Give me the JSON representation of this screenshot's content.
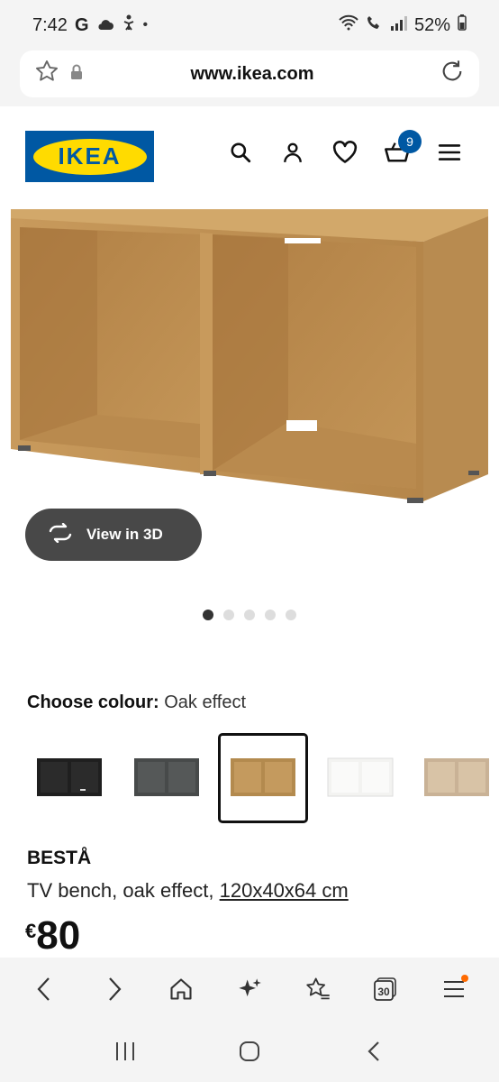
{
  "status": {
    "time": "7:42",
    "g_label": "G",
    "battery": "52%",
    "icons": [
      "cloud-icon",
      "accessibility-icon",
      "dot-icon",
      "wifi-icon",
      "call-icon",
      "signal-icon",
      "battery-icon"
    ]
  },
  "browser": {
    "url": "www.ikea.com",
    "icons": [
      "star-icon",
      "lock-icon",
      "reload-icon"
    ]
  },
  "header": {
    "logo_text": "IKEA",
    "cart_count": "9",
    "icons": [
      "search-icon",
      "user-icon",
      "heart-icon",
      "cart-icon",
      "menu-icon"
    ],
    "brand_colors": {
      "blue": "#0058a3",
      "yellow": "#ffdb00"
    }
  },
  "gallery": {
    "view3d_label": "View in 3D",
    "dot_count": 5,
    "active_index": 0
  },
  "colour": {
    "label": "Choose colour:",
    "value": "Oak effect",
    "options": [
      {
        "name": "black-brown",
        "color": "#1f1f1f",
        "selected": false
      },
      {
        "name": "dark-grey",
        "color": "#474a4a",
        "selected": false
      },
      {
        "name": "oak-effect",
        "color": "#b38a4e",
        "selected": true
      },
      {
        "name": "white",
        "color": "#f3f3f1",
        "selected": false
      },
      {
        "name": "white-stained-oak",
        "color": "#c9b296",
        "selected": false
      }
    ]
  },
  "product": {
    "name": "BESTÅ",
    "description": "TV bench, oak effect,",
    "dimensions": "120x40x64 cm",
    "currency": "€",
    "price": "80"
  },
  "toolbar": {
    "tabs_count": "30",
    "icons": [
      "back-icon",
      "forward-icon",
      "home-icon",
      "sparkle-icon",
      "bookmark-add-icon",
      "tabs-icon",
      "more-menu-icon"
    ]
  },
  "system_nav": {
    "icons": [
      "recents-icon",
      "home-button-icon",
      "back-nav-icon"
    ]
  }
}
